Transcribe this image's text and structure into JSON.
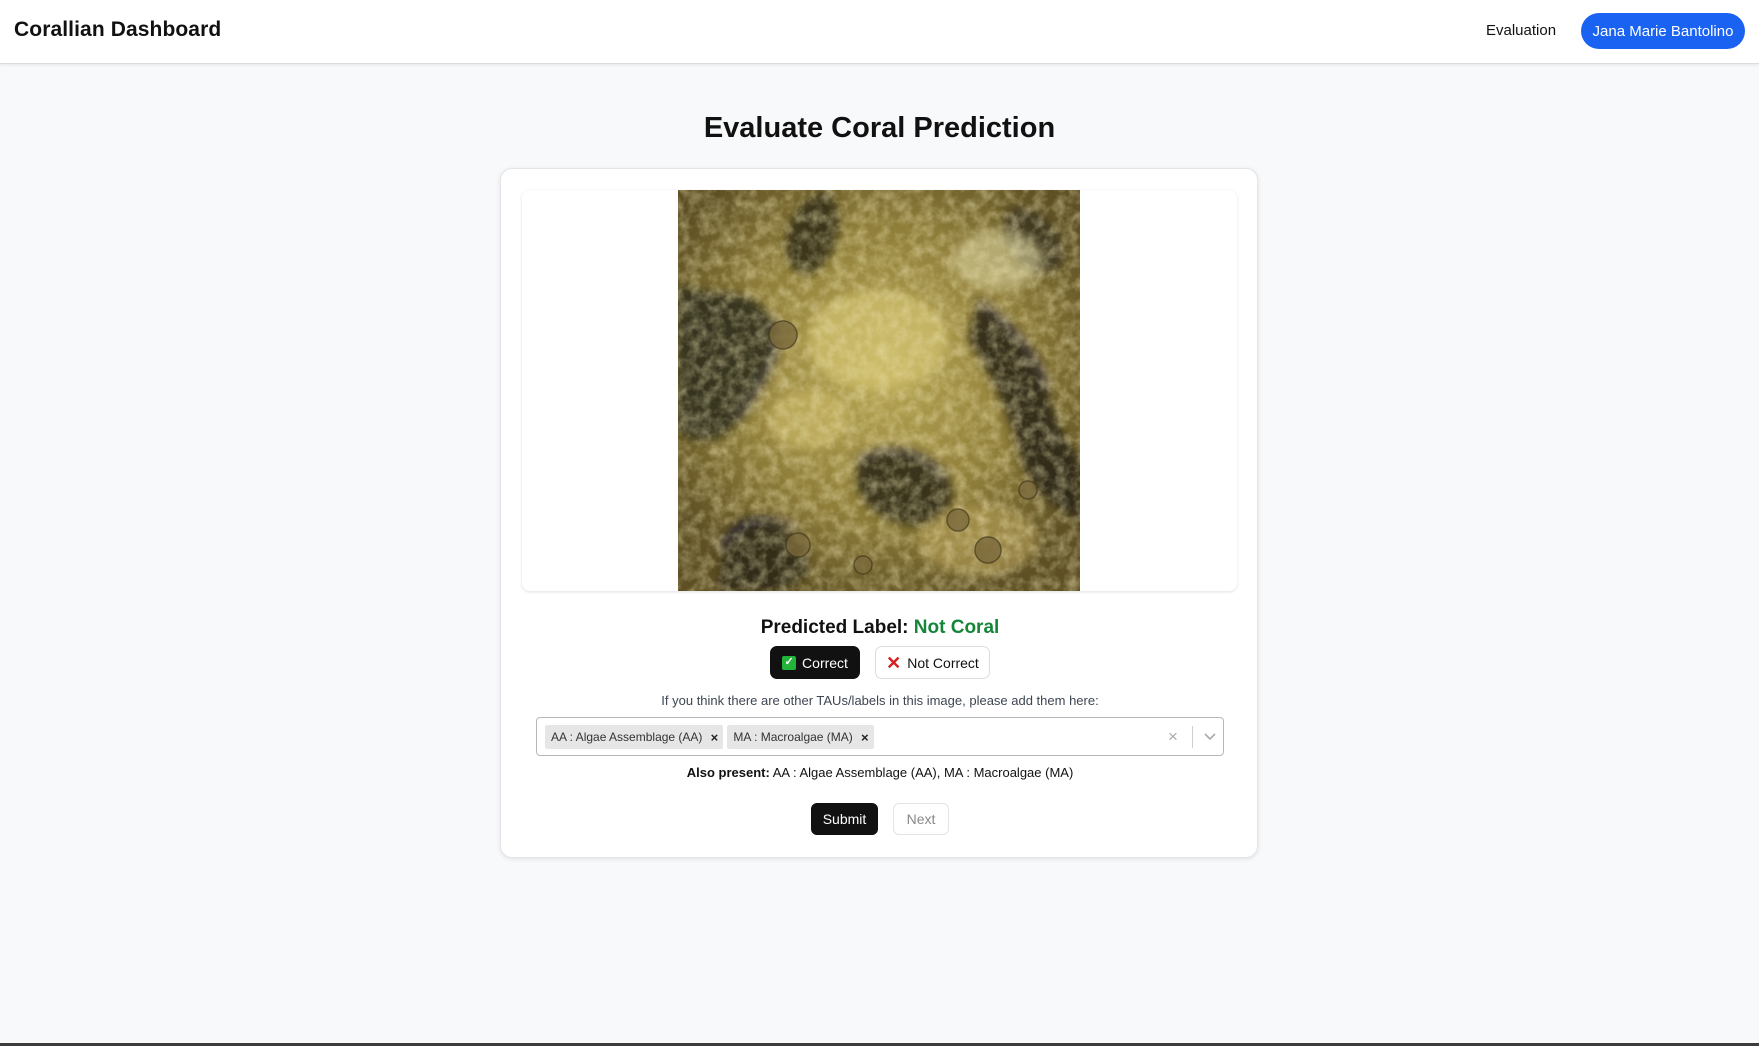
{
  "navbar": {
    "brand": "Corallian Dashboard",
    "nav_link": "Evaluation",
    "user_name": "Jana Marie Bantolino",
    "user_pill_color": "#1a62f2"
  },
  "page": {
    "title": "Evaluate Coral Prediction"
  },
  "prediction": {
    "label_prefix": "Predicted Label:",
    "label_value": "Not Coral",
    "label_value_color": "#16853a"
  },
  "evaluation": {
    "correct_label": "Correct",
    "correct_icon": "check-mark-icon",
    "not_correct_label": "Not Correct",
    "not_correct_icon": "cross-mark-icon"
  },
  "tau_selector": {
    "hint": "If you think there are other TAUs/labels in this image, please add them here:",
    "selected": [
      {
        "label": "AA : Algae Assemblage (AA)"
      },
      {
        "label": "MA : Macroalgae (MA)"
      }
    ],
    "remove_glyph": "×",
    "clear_glyph": "×"
  },
  "also_present": {
    "prefix": "Also present:",
    "text": "AA : Algae Assemblage (AA), MA : Macroalgae (MA)"
  },
  "actions": {
    "submit_label": "Submit",
    "next_label": "Next"
  }
}
